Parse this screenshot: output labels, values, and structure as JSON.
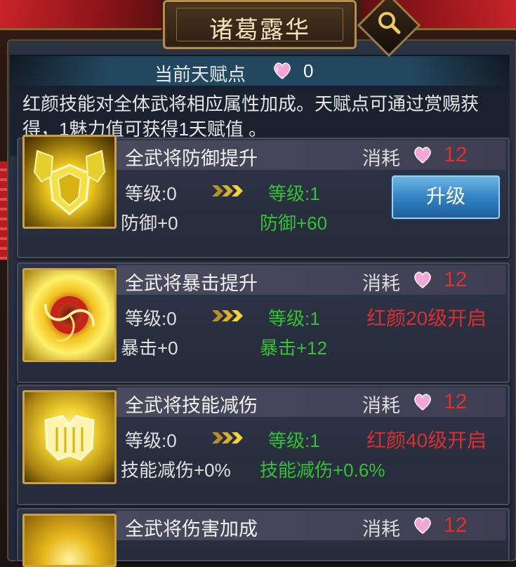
{
  "header": {
    "title": "诸葛露华",
    "search_icon": "magnifier-icon"
  },
  "talent": {
    "label": "当前天赋点",
    "icon": "pink-heart-icon",
    "value": "0"
  },
  "description": "红颜技能对全体武将相应属性加成。天赋点可通过赏赐获得，1魅力值可获得1天赋值 。",
  "colors": {
    "accent_gold": "#c8a24a",
    "green_next": "#34c234",
    "red_cost": "#e03030",
    "button_blue": "#2f7fbf"
  },
  "skills": [
    {
      "name": "全武将防御提升",
      "cost_label": "消耗",
      "cost_value": "12",
      "level_current": "等级:0",
      "level_next": "等级:1",
      "stat_current": "防御+0",
      "stat_next": "防御+60",
      "action": "升级",
      "icon": "shield-icon"
    },
    {
      "name": "全武将暴击提升",
      "cost_label": "消耗",
      "cost_value": "12",
      "level_current": "等级:0",
      "level_next": "等级:1",
      "stat_current": "暴击+0",
      "stat_next": "暴击+12",
      "lock_text": "红颜20级开启",
      "icon": "vortex-icon"
    },
    {
      "name": "全武将技能减伤",
      "cost_label": "消耗",
      "cost_value": "12",
      "level_current": "等级:0",
      "level_next": "等级:1",
      "stat_current": "技能减伤+0%",
      "stat_next": "技能减伤+0.6%",
      "lock_text": "红颜40级开启",
      "icon": "armor-icon"
    },
    {
      "name": "全武将伤害加成",
      "cost_label": "消耗",
      "cost_value": "12",
      "icon": "flame-icon"
    }
  ]
}
